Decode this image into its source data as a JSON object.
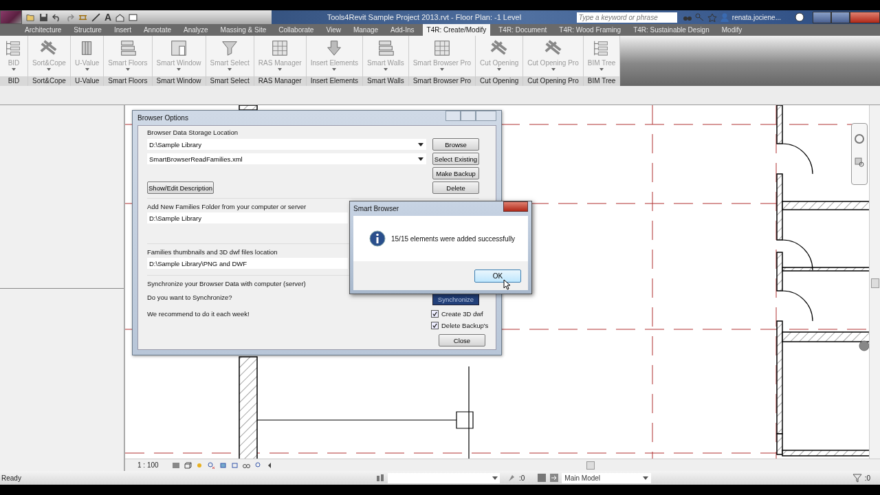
{
  "window": {
    "title": "Tools4Revit Sample Project 2013.rvt - Floor Plan: -1 Level"
  },
  "quick_access": {
    "text_tool": "A"
  },
  "search": {
    "placeholder": "Type a keyword or phrase"
  },
  "user": "renata.jociene...",
  "tabs": [
    {
      "label": "Architecture",
      "selected": false
    },
    {
      "label": "Structure",
      "selected": false
    },
    {
      "label": "Insert",
      "selected": false
    },
    {
      "label": "Annotate",
      "selected": false
    },
    {
      "label": "Analyze",
      "selected": false
    },
    {
      "label": "Massing & Site",
      "selected": false
    },
    {
      "label": "Collaborate",
      "selected": false
    },
    {
      "label": "View",
      "selected": false
    },
    {
      "label": "Manage",
      "selected": false
    },
    {
      "label": "Add-Ins",
      "selected": false
    },
    {
      "label": "T4R: Create/Modify",
      "selected": true
    },
    {
      "label": "T4R: Document",
      "selected": false
    },
    {
      "label": "T4R: Wood Framing",
      "selected": false
    },
    {
      "label": "T4R: Sustainable Design",
      "selected": false
    },
    {
      "label": "Modify",
      "selected": false
    }
  ],
  "ribbon_panels": [
    {
      "button": "BID",
      "caption": "BID",
      "kind": "tree"
    },
    {
      "button": "Sort&Cope",
      "caption": "Sort&Cope",
      "kind": "beam"
    },
    {
      "button": "U-Value",
      "caption": "U-Value",
      "kind": "block"
    },
    {
      "button": "Smart Floors",
      "caption": "Smart Floors",
      "kind": "layers"
    },
    {
      "button": "Smart Window",
      "caption": "Smart Window",
      "kind": "window"
    },
    {
      "button": "Smart Select",
      "caption": "Smart Select",
      "kind": "funnel"
    },
    {
      "button": "RAS Manager",
      "caption": "RAS Manager",
      "kind": "grid"
    },
    {
      "button": "Insert Elements",
      "caption": "Insert Elements",
      "kind": "arrow"
    },
    {
      "button": "Smart Walls",
      "caption": "Smart Walls",
      "kind": "layers"
    },
    {
      "button": "Smart Browser Pro",
      "caption": "Smart Browser Pro",
      "kind": "grid"
    },
    {
      "button": "Cut Opening",
      "caption": "Cut Opening",
      "kind": "beam"
    },
    {
      "button": "Cut Opening Pro",
      "caption": "Cut Opening Pro",
      "kind": "beam"
    },
    {
      "button": "BIM Tree",
      "caption": "BIM Tree",
      "kind": "tree"
    }
  ],
  "browser_options": {
    "title": "Browser Options",
    "storage_heading": "Browser Data Storage Location",
    "storage_path": "D:\\Sample Library",
    "storage_file": "SmartBrowserReadFamilies.xml",
    "buttons": [
      "Browse",
      "Select Existing",
      "Make Backup",
      "Delete"
    ],
    "show_edit": "Show/Edit Description",
    "add_heading": "Add New Families Folder from your computer or server",
    "add_path": "D:\\Sample Library",
    "thumb_heading": "Families thumbnails and 3D dwf files location",
    "thumb_path": "D:\\Sample Library\\PNG and DWF",
    "sync_heading": "Synchronize your Browser Data with computer (server)",
    "sync_question": "Do you want to Synchronize?",
    "sync_note": "We recommend to do it each week!",
    "sync_button": "Synchronize",
    "options": [
      {
        "label": "Create 3D dwf",
        "checked": true
      },
      {
        "label": "Delete Backup's",
        "checked": true
      }
    ],
    "close": "Close"
  },
  "message_box": {
    "title": "Smart Browser",
    "message": "15/15 elements were added successfully",
    "button": "OK"
  },
  "view_bar": {
    "scale": "1 : 100"
  },
  "status_bar": {
    "text": "Ready",
    "pinned_count": ":0",
    "model": "Main Model",
    "filter_count": ":0"
  }
}
